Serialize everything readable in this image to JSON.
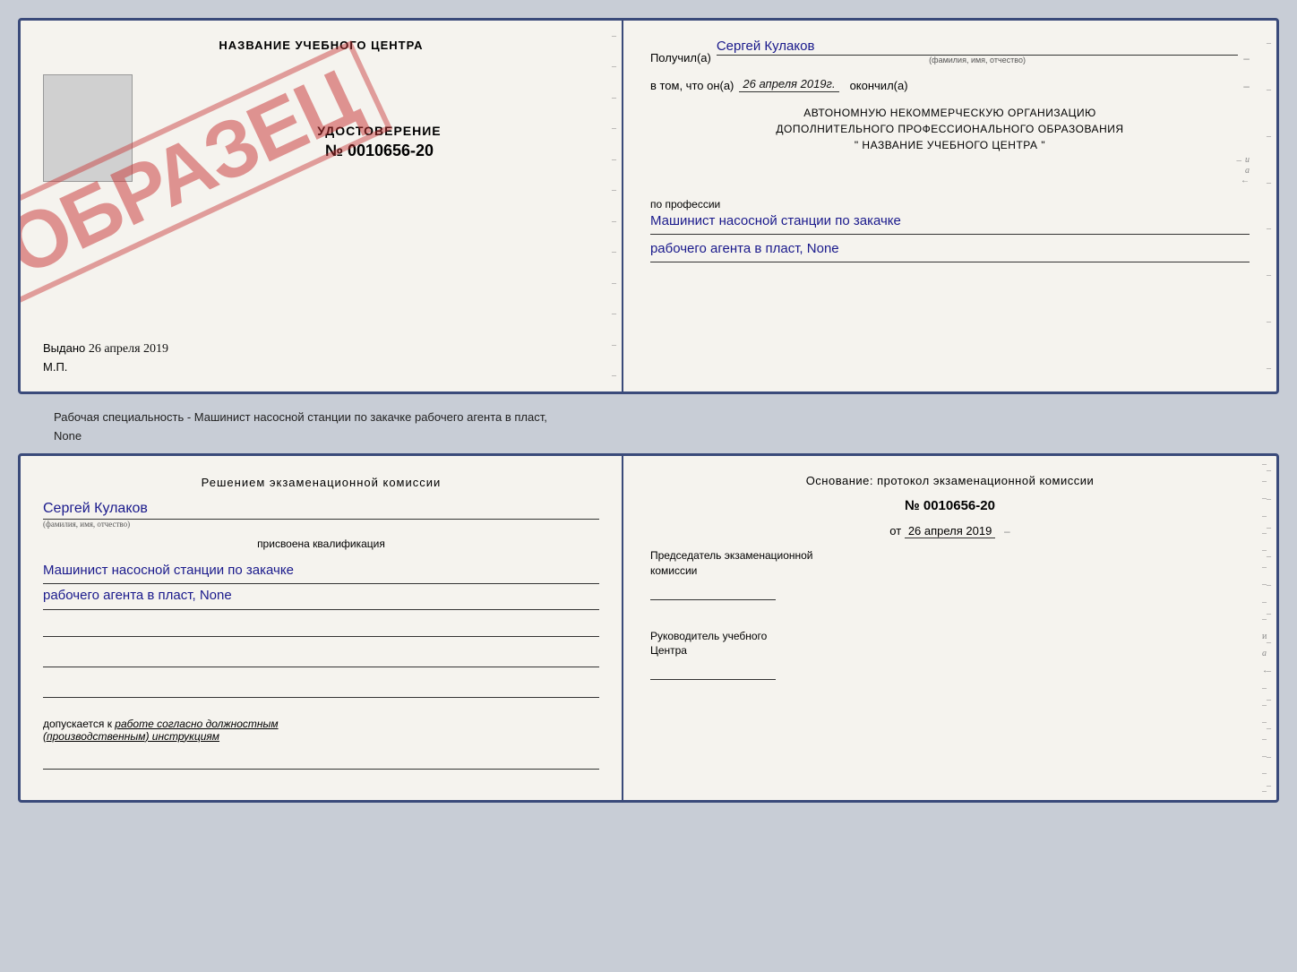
{
  "top_cert": {
    "left": {
      "title": "НАЗВАНИЕ УЧЕБНОГО ЦЕНТРА",
      "udostoverenie_label": "УДОСТОВЕРЕНИЕ",
      "number": "№ 0010656-20",
      "vydano_label": "Выдано",
      "vydano_date": "26 апреля 2019",
      "mp_label": "М.П.",
      "obrazets": "ОБРАЗЕЦ"
    },
    "right": {
      "poluchil_label": "Получил(a)",
      "poluchil_name": "Сергей Кулаков",
      "poluchil_hint": "(фамилия, имя, отчество)",
      "vtom_label": "в том, что он(а)",
      "vtom_date": "26 апреля 2019г.",
      "okonchil_label": "окончил(а)",
      "org_line1": "АВТОНОМНУЮ НЕКОММЕРЧЕСКУЮ ОРГАНИЗАЦИЮ",
      "org_line2": "ДОПОЛНИТЕЛЬНОГО ПРОФЕССИОНАЛЬНОГО ОБРАЗОВАНИЯ",
      "org_line3": "\"  НАЗВАНИЕ УЧЕБНОГО ЦЕНТРА  \"",
      "po_professii_label": "по профессии",
      "profession1": "Машинист насосной станции по закачке",
      "profession2": "рабочего агента в пласт, None"
    }
  },
  "bottom_label": {
    "text": "Рабочая специальность - Машинист насосной станции по закачке рабочего агента в пласт,",
    "text2": "None"
  },
  "bottom_cert": {
    "left": {
      "resheniem_text": "Решением  экзаменационной  комиссии",
      "name": "Сергей Кулаков",
      "name_hint": "(фамилия, имя, отчество)",
      "prisvoena_label": "присвоена квалификация",
      "qualification1": "Машинист насосной станции по закачке",
      "qualification2": "рабочего агента в пласт, None",
      "dopuskaetsya_label": "допускается к",
      "dopuskaetsya_value": "работе согласно должностным",
      "dopuskaetsya_value2": "(производственным) инструкциям"
    },
    "right": {
      "osnovaniye_text": "Основание: протокол экзаменационной  комиссии",
      "number": "№  0010656-20",
      "date_prefix": "от",
      "date": "26 апреля 2019",
      "predsedatel_label": "Председатель экзаменационной",
      "predsedatel_label2": "комиссии",
      "ruk_label": "Руководитель учебного",
      "ruk_label2": "Центра"
    }
  }
}
